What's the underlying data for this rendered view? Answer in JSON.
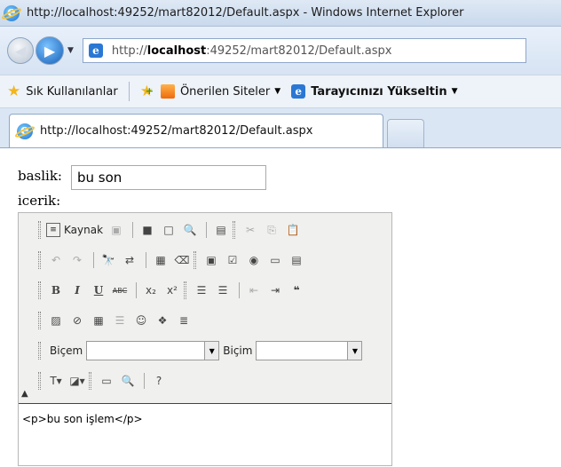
{
  "window": {
    "title": "http://localhost:49252/mart82012/Default.aspx - Windows Internet Explorer"
  },
  "nav": {
    "address_prefix": "http://",
    "address_host": "localhost",
    "address_rest": ":49252/mart82012/Default.aspx"
  },
  "favorites": {
    "label": "Sık Kullanılanlar",
    "suggested": "Önerilen Siteler",
    "upgrade": "Tarayıcınızı Yükseltin"
  },
  "tab": {
    "title": "http://localhost:49252/mart82012/Default.aspx"
  },
  "form": {
    "title_label": "baslik:",
    "title_value": "bu son",
    "content_label": "icerik:"
  },
  "editor": {
    "source_label": "Kaynak",
    "style_label": "Biçem",
    "format_label": "Biçim",
    "content": "<p>bu son işlem</p>"
  },
  "colors": {
    "accent": "#1a6fd1",
    "star": "#f2b51c",
    "toolbar_bg": "#f0f0ee"
  }
}
